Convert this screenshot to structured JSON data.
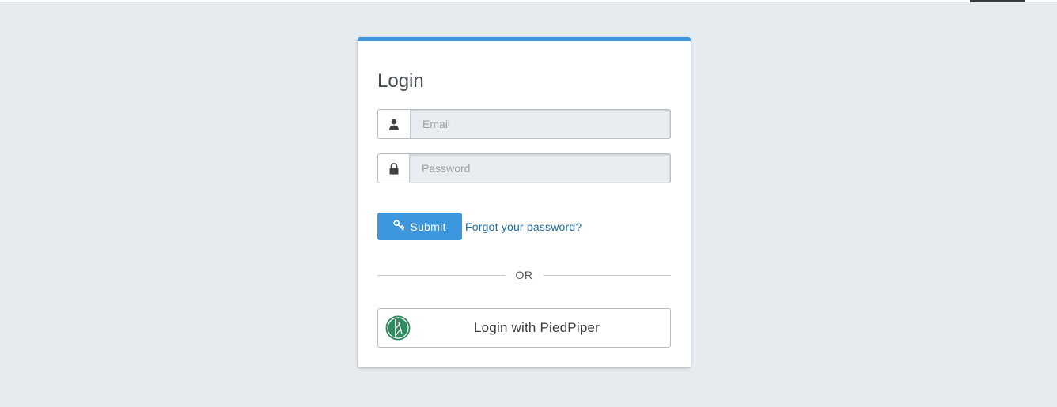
{
  "login": {
    "title": "Login",
    "email": {
      "icon": "user-icon",
      "placeholder": "Email",
      "value": ""
    },
    "password": {
      "icon": "lock-icon",
      "placeholder": "Password",
      "value": ""
    },
    "submit": {
      "icon": "key-icon",
      "label": "Submit"
    },
    "forgot_link": "Forgot your password?",
    "divider_text": "OR",
    "oauth": {
      "icon": "piedpiper-logo-icon",
      "label": "Login with PiedPiper"
    }
  },
  "colors": {
    "page_background": "#e6ebef",
    "accent": "#3c96dd",
    "link": "#1f6aa5",
    "logo_green": "#2f8a5f"
  }
}
